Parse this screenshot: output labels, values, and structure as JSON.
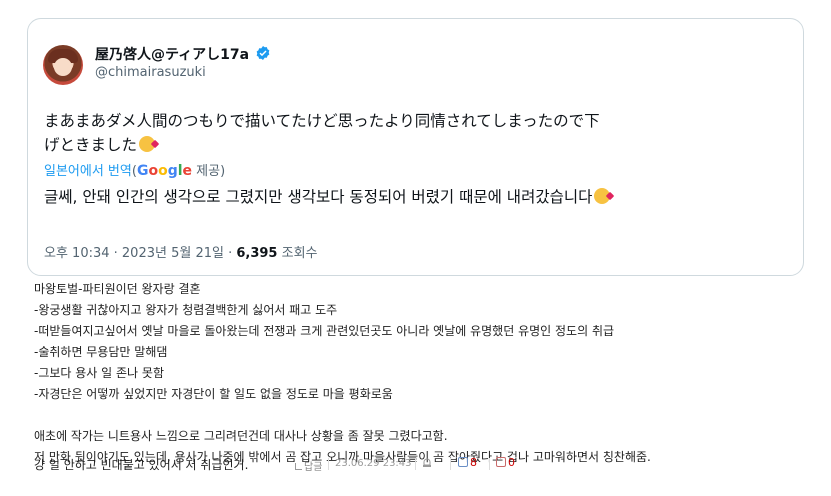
{
  "tweet": {
    "display_name": "屋乃啓人@ティアし17a",
    "handle": "@chimairasuzuki",
    "original_text": "まあまあダメ人間のつもりで描いてたけど思ったより同情されてしまったので下げときました",
    "translation_label": "일본어에서 번역",
    "translation_provider_prefix": "(",
    "translation_provider_suffix": " 제공)",
    "google": [
      "G",
      "o",
      "o",
      "g",
      "l",
      "e"
    ],
    "translated_text": "글쎄, 안돼 인간의 생각으로 그렸지만 생각보다 동정되어 버렸기 때문에 내려갔습니다",
    "time": "오후 10:34 · 2023년 5월 21일 · ",
    "views_count": "6,395",
    "views_label": " 조회수"
  },
  "comment": {
    "lines": [
      "마왕토벌-파티원이던 왕자랑 결혼",
      "-왕궁생활 귀찮아지고 왕자가 청렴결백한게 싫어서 패고 도주",
      "-떠받들여지고싶어서 옛날 마을로 돌아왔는데 전쟁과 크게 관련있던곳도 아니라 옛날에 유명했던 유명인 정도의 취급",
      "-술취하면 무용담만 말해댐",
      "-그보다 용사 일 존나 못함",
      "-자경단은 어떻까 싶었지만 자경단이 할 일도 없을 정도로 마을 평화로움"
    ],
    "lines2": [
      "애초에 작가는 니트용사 느낌으로 그리려던건데 대사나 상황을 좀 잘못 그렸다고함.",
      "저 만화 뒷이야기도 있는데, 용사가 나중에 밖에서 곰 잡고 오니까 마을사람들이 곰 잡아줬다고 겁나 고마워하면서 칭찬해줌."
    ],
    "last_line": "걍 일 안하고 빈대붙고 있어서 저 취급인거.",
    "reply_label": "답글",
    "timestamp": "23.06.29 23:43",
    "up_count": "8",
    "down_count": "0"
  },
  "colors": {
    "link": "#1d9bf0",
    "muted": "#536471",
    "border": "#cfd9de",
    "vote": "#cc0000"
  }
}
